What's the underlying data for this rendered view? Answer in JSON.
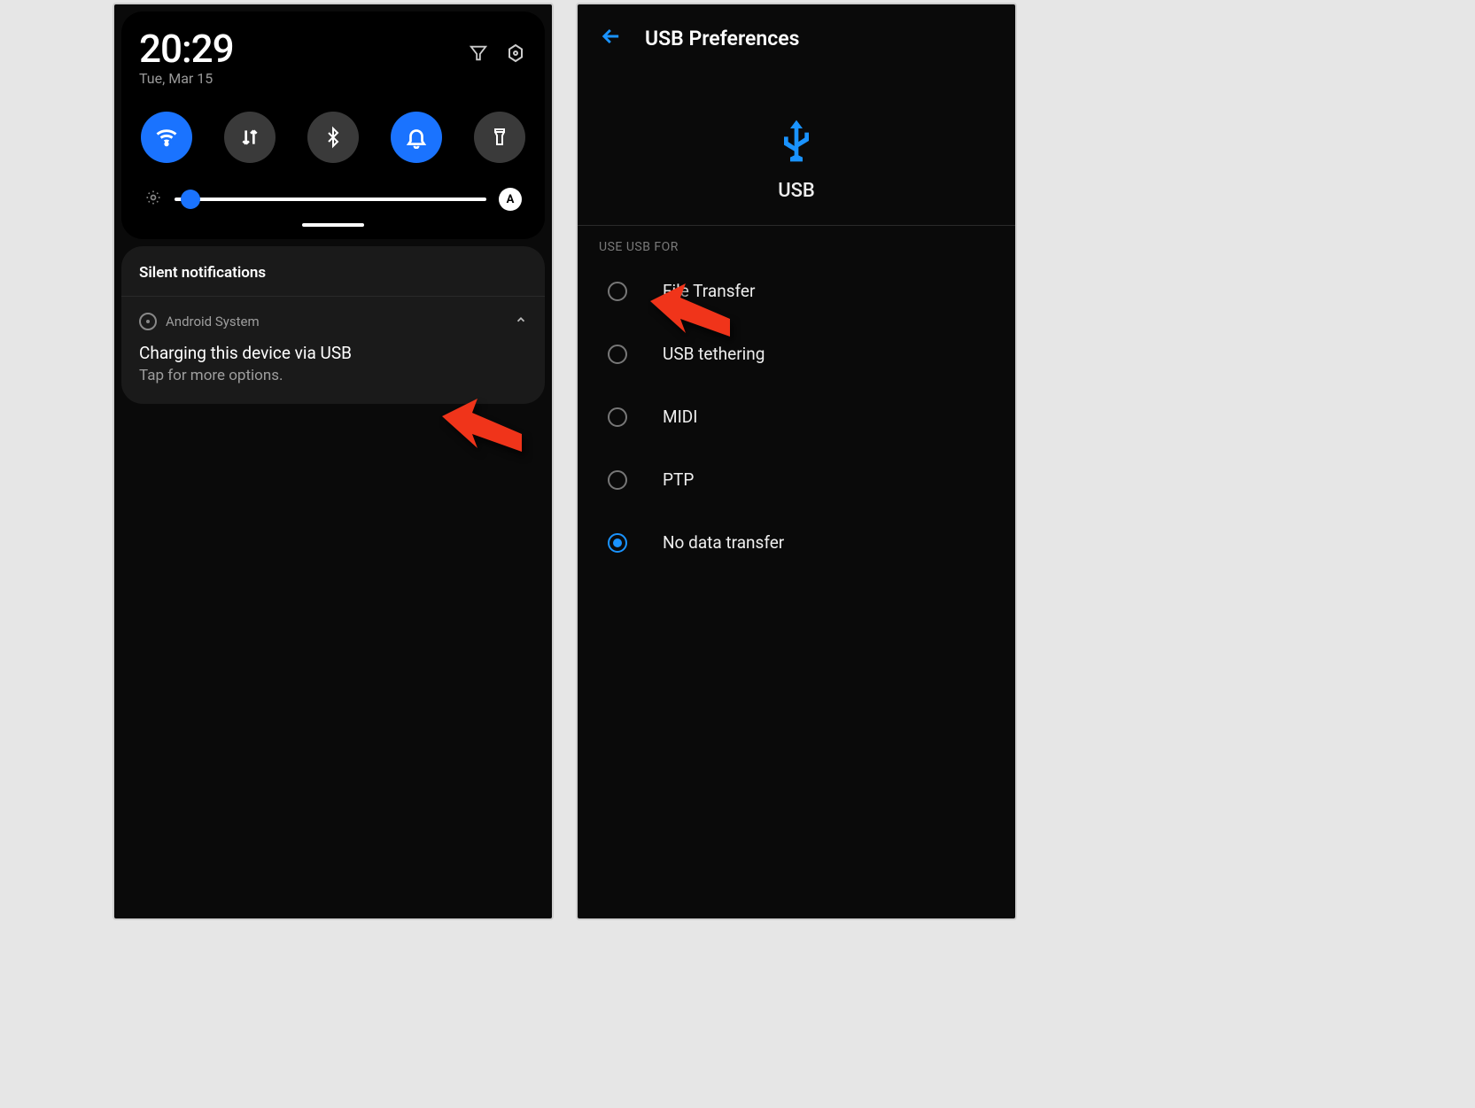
{
  "left": {
    "time": "20:29",
    "date": "Tue, Mar 15",
    "toggles": [
      {
        "name": "wifi",
        "active": true
      },
      {
        "name": "data",
        "active": false
      },
      {
        "name": "bluetooth",
        "active": false
      },
      {
        "name": "dnd",
        "active": true
      },
      {
        "name": "flashlight",
        "active": false
      }
    ],
    "brightness": {
      "value": 5,
      "auto_label": "A"
    },
    "silent_header": "Silent notifications",
    "notification": {
      "source": "Android System",
      "title": "Charging this device via USB",
      "subtitle": "Tap for more options."
    }
  },
  "right": {
    "page_title": "USB Preferences",
    "emblem_label": "USB",
    "section_label": "USE USB FOR",
    "options": [
      {
        "label": "File Transfer",
        "selected": false
      },
      {
        "label": "USB tethering",
        "selected": false
      },
      {
        "label": "MIDI",
        "selected": false
      },
      {
        "label": "PTP",
        "selected": false
      },
      {
        "label": "No data transfer",
        "selected": true
      }
    ]
  },
  "colors": {
    "accent": "#1a93ff",
    "arrow": "#f0341a"
  }
}
